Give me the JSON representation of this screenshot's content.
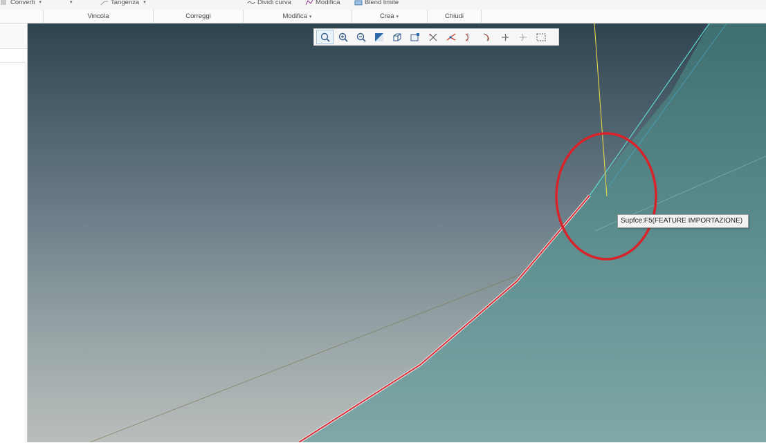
{
  "ribbon": {
    "top_items": [
      {
        "label": "Converti",
        "caret": "▾",
        "icon": "convert-icon"
      },
      {
        "label": "",
        "caret": "▾",
        "icon": "dropdown-icon"
      },
      {
        "label": "Tangenza",
        "caret": "▾",
        "icon": "tangent-icon"
      },
      {
        "label": "Dividi curva",
        "icon": "split-curve-icon"
      },
      {
        "label": "Modifica",
        "icon": "modify-icon"
      },
      {
        "label": "Blend limite",
        "icon": "boundary-blend-icon"
      }
    ],
    "groups": [
      {
        "label": "Vincola",
        "caret": ""
      },
      {
        "label": "Correggi",
        "caret": ""
      },
      {
        "label": "Modifica",
        "caret": "▾"
      },
      {
        "label": "Crea",
        "caret": "▾"
      },
      {
        "label": "Chiudi",
        "caret": ""
      }
    ]
  },
  "view_toolbar": {
    "buttons": [
      "zoom-fit-icon",
      "zoom-in-icon",
      "zoom-out-icon",
      "repaint-icon",
      "display-style-icon",
      "saved-views-icon",
      "datum-display-icon",
      "curve-connect-icon",
      "curvature-icon",
      "reflection-icon",
      "draft-icon",
      "slope-icon",
      "box-select-icon"
    ]
  },
  "tooltip": {
    "text": "Supfce:F5(FEATURE IMPORTAZIONE)"
  },
  "colors": {
    "highlight_curve": "#d8303a",
    "annotation_circle": "#d8232a",
    "axis_yellow": "#e9d84a",
    "edge_cyan": "#5fd6d0"
  }
}
